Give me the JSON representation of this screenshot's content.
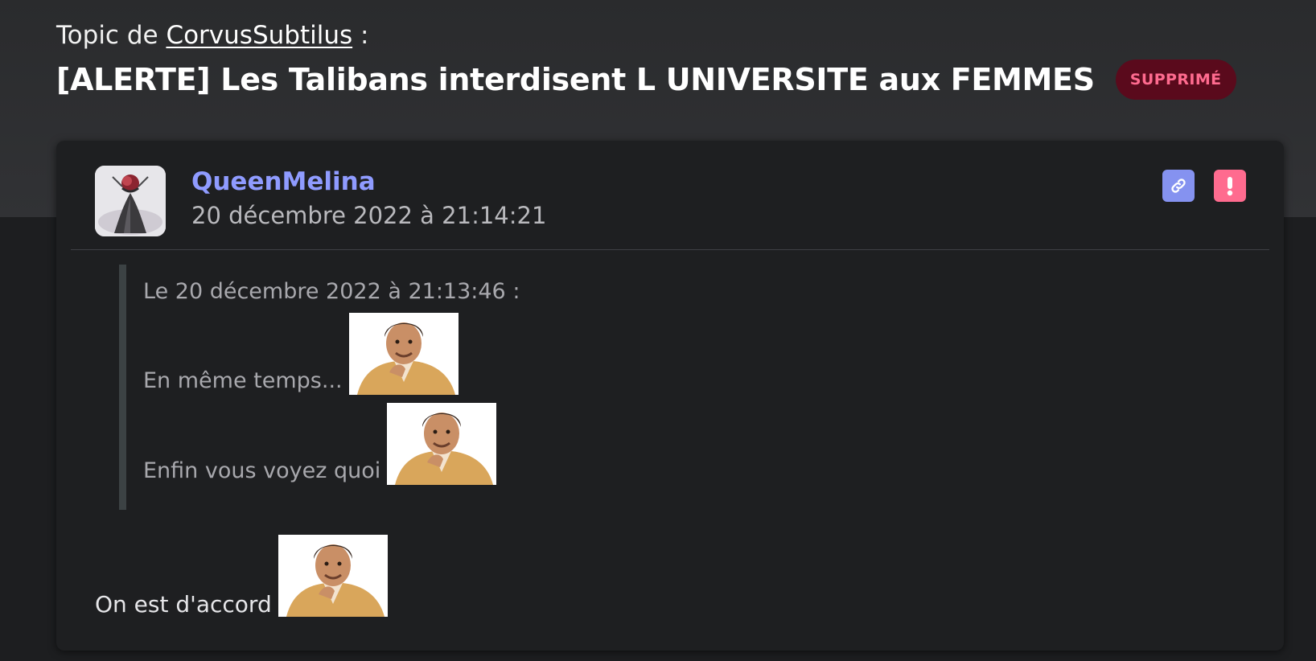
{
  "topic": {
    "prefix": "Topic de",
    "author": "CorvusSubtilus",
    "suffix": ":",
    "title": "[ALERTE] Les Talibans interdisent L UNIVERSITE aux FEMMES",
    "status": "SUPPRIMÉ"
  },
  "post": {
    "username": "QueenMelina",
    "date": "20 décembre 2022 à 21:14:21",
    "actions": [
      {
        "name": "permalink",
        "icon": "link-icon"
      },
      {
        "name": "report",
        "icon": "exclamation-icon"
      }
    ],
    "quote": {
      "heading": "Le 20 décembre 2022 à 21:13:46 :",
      "lines": [
        "En même temps...",
        "Enfin vous voyez quoi"
      ]
    },
    "body": "On est d'accord",
    "sticker_icon": "smiling-man-sticker"
  },
  "colors": {
    "username": "#8f9bff",
    "badge_bg": "#5a0a1c",
    "badge_text": "#ff6b8f",
    "link_button": "#8592f0",
    "report_button": "#ff6b8f"
  }
}
